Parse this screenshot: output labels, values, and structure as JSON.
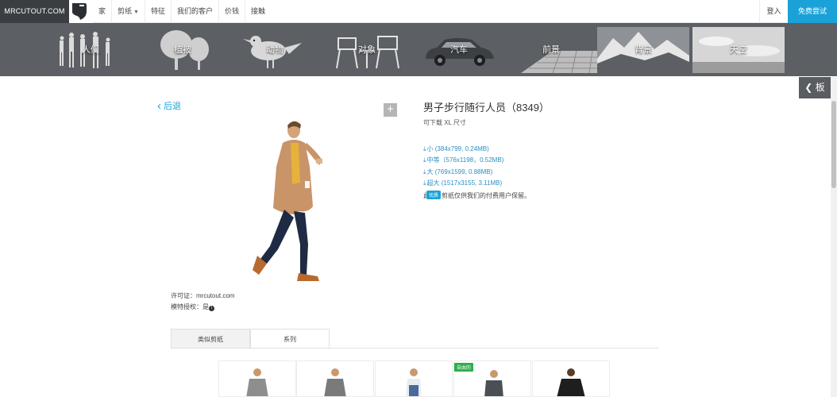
{
  "header": {
    "brand": "MRCUTOUT.COM",
    "nav": [
      {
        "label": "家",
        "dropdown": false
      },
      {
        "label": "剪纸",
        "dropdown": true
      },
      {
        "label": "特征",
        "dropdown": false
      },
      {
        "label": "我们的客户",
        "dropdown": false
      },
      {
        "label": "价钱",
        "dropdown": false
      },
      {
        "label": "接触",
        "dropdown": false
      }
    ],
    "login_label": "登入",
    "trial_label": "免费尝试",
    "accent_color": "#1aa2d8"
  },
  "categories": [
    {
      "label": "人们"
    },
    {
      "label": "植被"
    },
    {
      "label": "动物"
    },
    {
      "label": "对象"
    },
    {
      "label": "汽车"
    },
    {
      "label": "前景"
    },
    {
      "label": "背景"
    },
    {
      "label": "天空"
    }
  ],
  "side_tab": {
    "label": "板",
    "icon": "chevron-left-icon"
  },
  "detail": {
    "back_label": "后退",
    "title": "男子步行随行人员（8349）",
    "subtitle": "可下载 XL 尺寸",
    "downloads": [
      {
        "label": "小 (384x799, 0.24MB)"
      },
      {
        "label": "中等（576x1198，0.52MB)"
      },
      {
        "label": "大 (769x1599, 0.88MB)"
      },
      {
        "label": "超大 (1517x3155, 3.11MB)"
      }
    ],
    "note_prefix": "此",
    "note_badge": "优质",
    "note_suffix": "剪纸仅供我们的付费用户保留。",
    "license": "许可证：mrcutout.com",
    "model_release": "模特授权：是",
    "tabs": [
      {
        "label": "类似剪纸",
        "active": true
      },
      {
        "label": "系列",
        "active": false
      }
    ],
    "thumbnails": [
      {
        "badge": ""
      },
      {
        "badge": ""
      },
      {
        "badge": ""
      },
      {
        "badge": "自由的"
      },
      {
        "badge": ""
      }
    ]
  }
}
